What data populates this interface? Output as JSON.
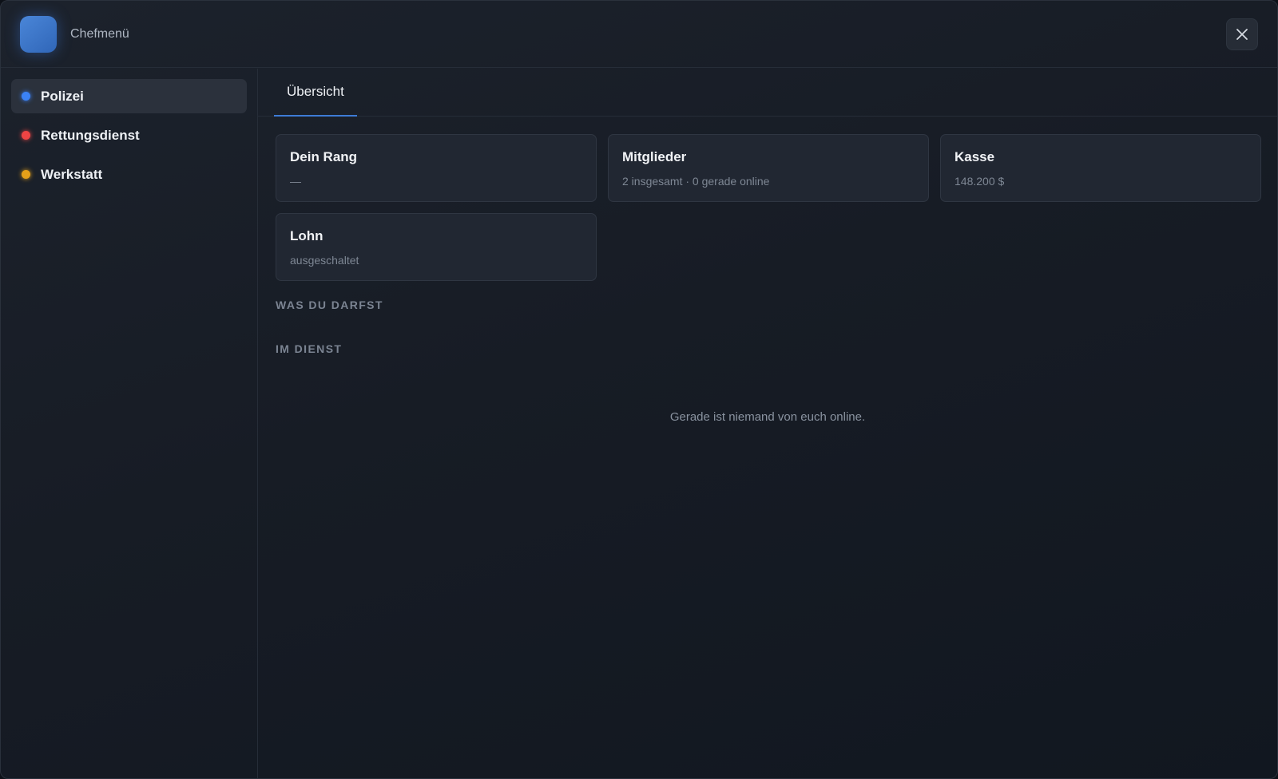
{
  "header": {
    "title": "Chefmenü"
  },
  "sidebar": {
    "items": [
      {
        "label": "Polizei",
        "color": "#3b82f6",
        "active": true
      },
      {
        "label": "Rettungsdienst",
        "color": "#ef4444",
        "active": false
      },
      {
        "label": "Werkstatt",
        "color": "#e6a019",
        "active": false
      }
    ]
  },
  "tabs": [
    {
      "label": "Übersicht",
      "active": true
    }
  ],
  "cards": {
    "rank": {
      "title": "Dein Rang",
      "value": "—"
    },
    "members": {
      "title": "Mitglieder",
      "value": "2 insgesamt · 0 gerade online"
    },
    "cash": {
      "title": "Kasse",
      "value": "148.200 $"
    },
    "wage": {
      "title": "Lohn",
      "value": "ausgeschaltet"
    }
  },
  "sections": {
    "permissions": "WAS DU DARFST",
    "on_duty": "IM DIENST"
  },
  "on_duty_empty": "Gerade ist niemand von euch online.",
  "colors": {
    "accent": "#3d7bd6"
  }
}
